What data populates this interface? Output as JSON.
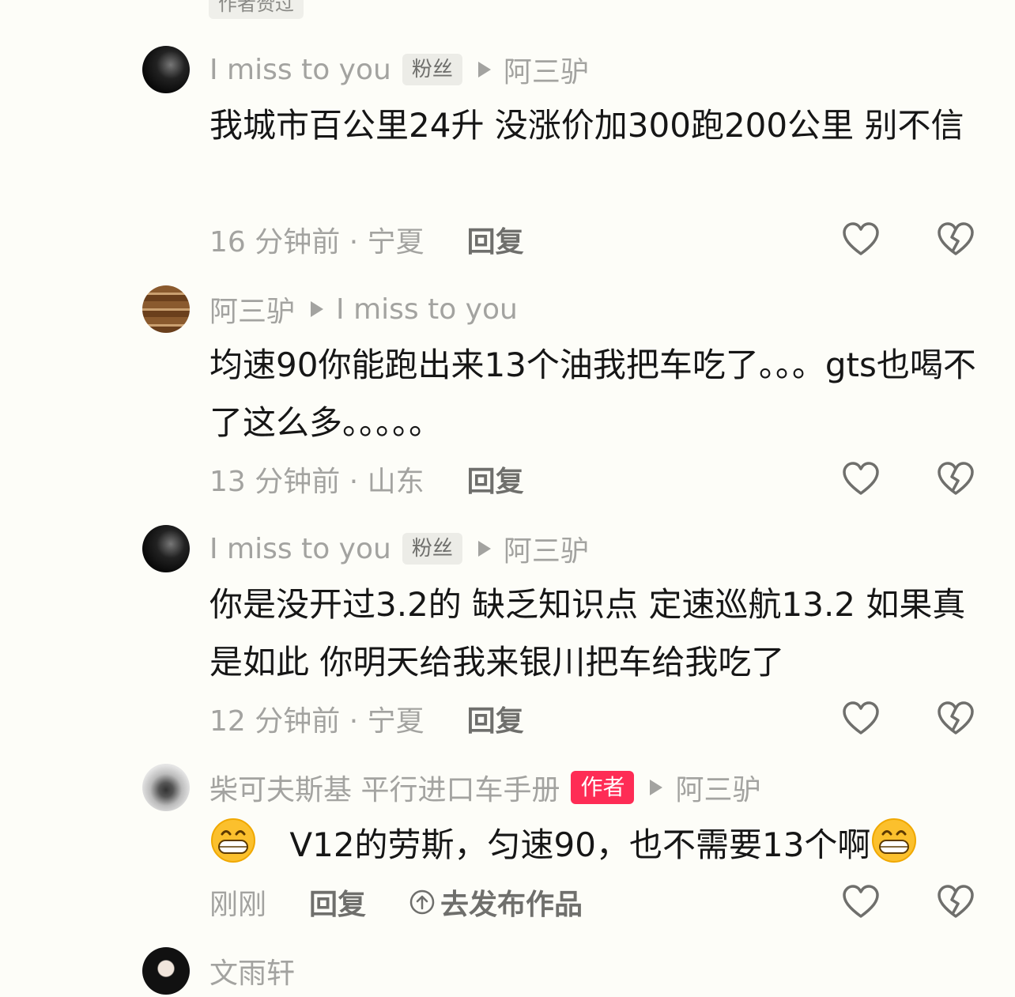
{
  "top_tag": "作者赞过",
  "comments": [
    {
      "user": "I miss to you",
      "badge": "粉丝",
      "reply_to": "阿三驴",
      "text": "我城市百公里24升 没涨价加300跑200公里 别不信",
      "time_location": "16 分钟前 · 宁夏",
      "reply_label": "回复"
    },
    {
      "user": "阿三驴",
      "reply_to": "I miss to you",
      "text": "均速90你能跑出来13个油我把车吃了。。。gts也喝不了这么多。。。。。",
      "time_location": "13 分钟前 · 山东",
      "reply_label": "回复"
    },
    {
      "user": "I miss to you",
      "badge": "粉丝",
      "reply_to": "阿三驴",
      "text": "你是没开过3.2的 缺乏知识点 定速巡航13.2 如果真是如此 你明天给我来银川把车给我吃了",
      "time_location": "12 分钟前 · 宁夏",
      "reply_label": "回复"
    },
    {
      "user": "柴可夫斯基 平行进口车手册",
      "badge": "作者",
      "reply_to": "阿三驴",
      "text": "V12的劳斯，匀速90，也不需要13个啊",
      "time_location": "刚刚",
      "reply_label": "回复",
      "publish_label": "去发布作品"
    },
    {
      "user": "文雨轩"
    }
  ],
  "colors": {
    "background": "#fdfdf8",
    "muted_text": "#a3a3a0",
    "author_badge": "#fe2c55"
  }
}
